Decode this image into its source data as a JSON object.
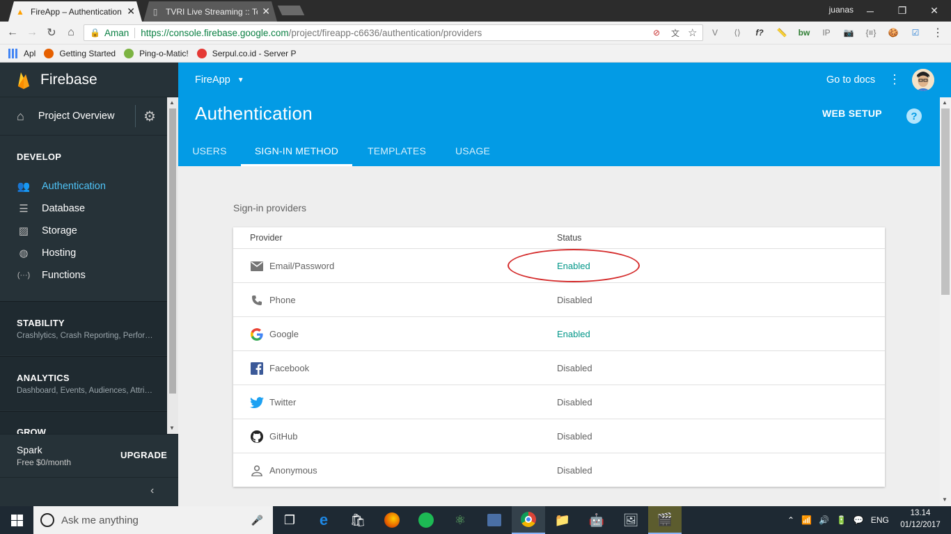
{
  "browser": {
    "tabs": [
      {
        "title": "FireApp – Authentication",
        "active": true
      },
      {
        "title": "TVRI Live Streaming :: Tel",
        "active": false
      }
    ],
    "user": "juanas",
    "security_label": "Aman",
    "url_host": "https://console.firebase.google.com",
    "url_path": "/project/fireapp-c6636/authentication/providers",
    "bookmarks": [
      {
        "label": "Apl",
        "color": "#4285f4"
      },
      {
        "label": "Getting Started",
        "color": "#e66000"
      },
      {
        "label": "Ping-o-Matic!",
        "color": "#7cb342"
      },
      {
        "label": "Serpul.co.id - Server P",
        "color": "#e53935"
      }
    ],
    "extensions": [
      "V",
      "⟨⟩",
      "f?",
      "📏",
      "bw",
      "IP",
      "📷",
      "{≡}",
      "🍪",
      "☑",
      "⋮"
    ]
  },
  "sidebar": {
    "brand": "Firebase",
    "project_overview": "Project Overview",
    "develop_heading": "DEVELOP",
    "develop_items": [
      {
        "label": "Authentication",
        "icon": "people-icon",
        "glyph": "👥",
        "active": true
      },
      {
        "label": "Database",
        "icon": "database-icon",
        "glyph": "☰",
        "active": false
      },
      {
        "label": "Storage",
        "icon": "storage-icon",
        "glyph": "▨",
        "active": false
      },
      {
        "label": "Hosting",
        "icon": "globe-icon",
        "glyph": "◍",
        "active": false
      },
      {
        "label": "Functions",
        "icon": "functions-icon",
        "glyph": "(···)",
        "active": false
      }
    ],
    "stability": {
      "heading": "STABILITY",
      "sub": "Crashlytics, Crash Reporting, Performance"
    },
    "analytics": {
      "heading": "ANALYTICS",
      "sub": "Dashboard, Events, Audiences, Attribution"
    },
    "grow": {
      "heading": "GROW"
    },
    "plan": {
      "name": "Spark",
      "price": "Free $0/month",
      "upgrade": "UPGRADE"
    }
  },
  "header": {
    "app_name": "FireApp",
    "go_to_docs": "Go to docs",
    "title": "Authentication",
    "web_setup": "WEB SETUP",
    "tabs": [
      "USERS",
      "SIGN-IN METHOD",
      "TEMPLATES",
      "USAGE"
    ],
    "active_tab": "SIGN-IN METHOD"
  },
  "providers": {
    "section_title": "Sign-in providers",
    "col_provider": "Provider",
    "col_status": "Status",
    "rows": [
      {
        "name": "Email/Password",
        "status": "Enabled",
        "icon": "mail-icon"
      },
      {
        "name": "Phone",
        "status": "Disabled",
        "icon": "phone-icon"
      },
      {
        "name": "Google",
        "status": "Enabled",
        "icon": "google-icon"
      },
      {
        "name": "Facebook",
        "status": "Disabled",
        "icon": "facebook-icon"
      },
      {
        "name": "Twitter",
        "status": "Disabled",
        "icon": "twitter-icon"
      },
      {
        "name": "GitHub",
        "status": "Disabled",
        "icon": "github-icon"
      },
      {
        "name": "Anonymous",
        "status": "Disabled",
        "icon": "person-icon"
      }
    ]
  },
  "taskbar": {
    "search_placeholder": "Ask me anything",
    "lang": "ENG",
    "time": "13.14",
    "date": "01/12/2017"
  }
}
